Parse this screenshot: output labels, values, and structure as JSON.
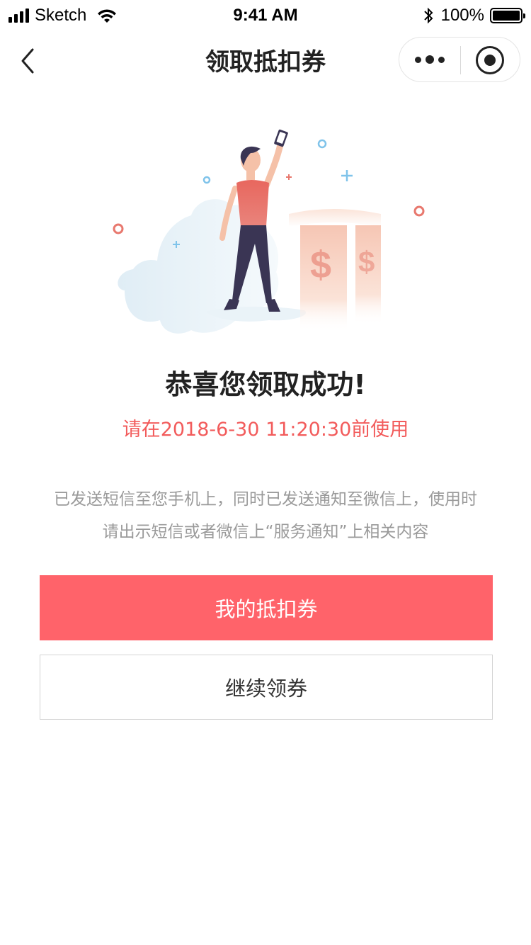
{
  "status_bar": {
    "carrier": "Sketch",
    "time": "9:41 AM",
    "battery": "100%"
  },
  "nav": {
    "title": "领取抵扣券"
  },
  "content": {
    "success_title": "恭喜您领取成功!",
    "expire_text": "请在2018-6-30 11:20:30前使用",
    "notice_line1": "已发送短信至您手机上，同时已发送通知至微信上，使用时",
    "notice_line2": "请出示短信或者微信上“服务通知”上相关内容"
  },
  "actions": {
    "my_coupons": "我的抵扣券",
    "continue_label": "继续领券"
  },
  "illustration": {
    "symbol": "$"
  },
  "colors": {
    "accent": "#ff636a",
    "expire": "#f25b5b",
    "notice": "#9a9a9a"
  }
}
